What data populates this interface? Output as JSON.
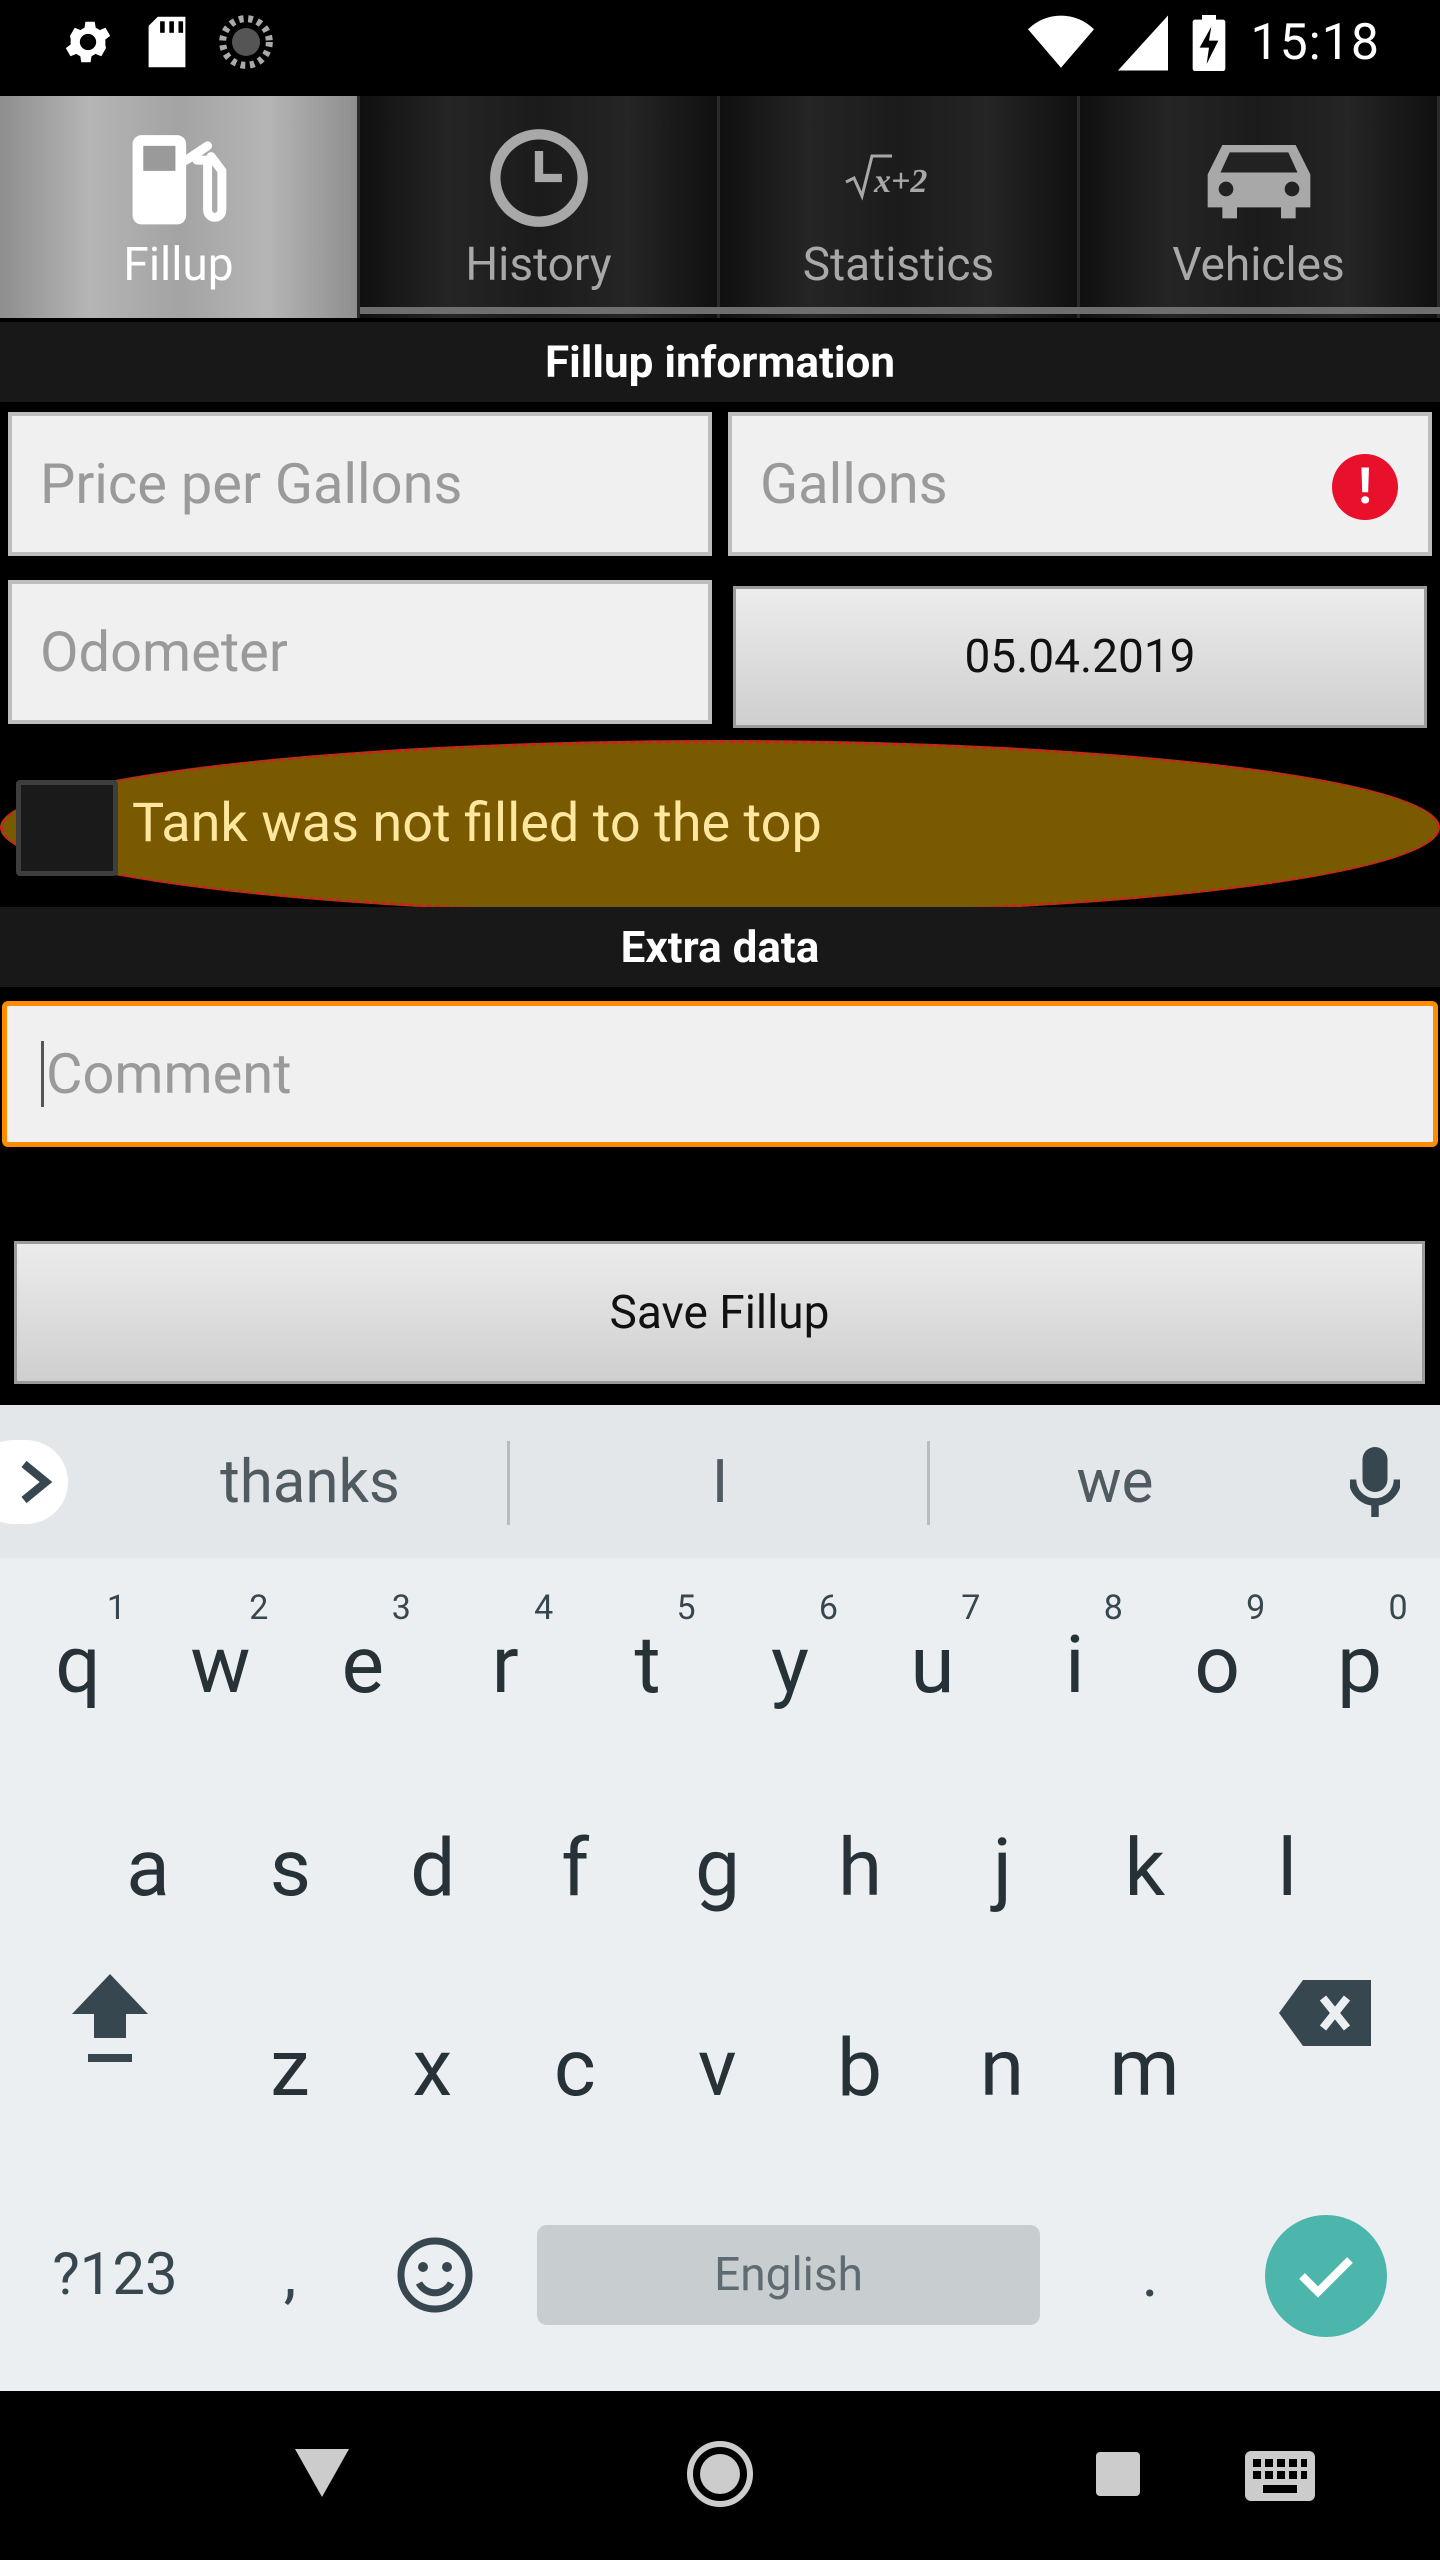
{
  "status_bar": {
    "time": "15:18",
    "left_icons": [
      "settings-icon",
      "sd-card-icon",
      "sync-spinner-icon"
    ],
    "right_icons": [
      "wifi-icon",
      "cell-signal-icon",
      "battery-charging-icon"
    ]
  },
  "tabs": [
    {
      "label": "Fillup",
      "icon": "fuel-pump-icon",
      "active": true
    },
    {
      "label": "History",
      "icon": "clock-icon",
      "active": false
    },
    {
      "label": "Statistics",
      "icon": "formula-icon",
      "active": false
    },
    {
      "label": "Vehicles",
      "icon": "car-icon",
      "active": false
    }
  ],
  "fillup_section": {
    "header": "Fillup information",
    "price_placeholder": "Price per Gallons",
    "gallons_placeholder": "Gallons",
    "odometer_placeholder": "Odometer",
    "date_value": "05.04.2019",
    "partial_fill_label": "Tank was not filled to the top",
    "partial_fill_checked": false
  },
  "extra_section": {
    "header": "Extra data",
    "comment_placeholder": "Comment"
  },
  "save_button_label": "Save Fillup",
  "keyboard": {
    "suggestions": [
      "thanks",
      "I",
      "we"
    ],
    "row1": [
      {
        "ch": "q",
        "hint": "1"
      },
      {
        "ch": "w",
        "hint": "2"
      },
      {
        "ch": "e",
        "hint": "3"
      },
      {
        "ch": "r",
        "hint": "4"
      },
      {
        "ch": "t",
        "hint": "5"
      },
      {
        "ch": "y",
        "hint": "6"
      },
      {
        "ch": "u",
        "hint": "7"
      },
      {
        "ch": "i",
        "hint": "8"
      },
      {
        "ch": "o",
        "hint": "9"
      },
      {
        "ch": "p",
        "hint": "0"
      }
    ],
    "row2": [
      "a",
      "s",
      "d",
      "f",
      "g",
      "h",
      "j",
      "k",
      "l"
    ],
    "row3": [
      "z",
      "x",
      "c",
      "v",
      "b",
      "n",
      "m"
    ],
    "symbols_label": "?123",
    "comma_label": ",",
    "period_label": ".",
    "space_label": "English"
  },
  "colors": {
    "accent_focus": "#ff8c00",
    "highlight_fill": "#7a5a00",
    "error_red": "#e8102a",
    "enter_key": "#4db6ac"
  }
}
